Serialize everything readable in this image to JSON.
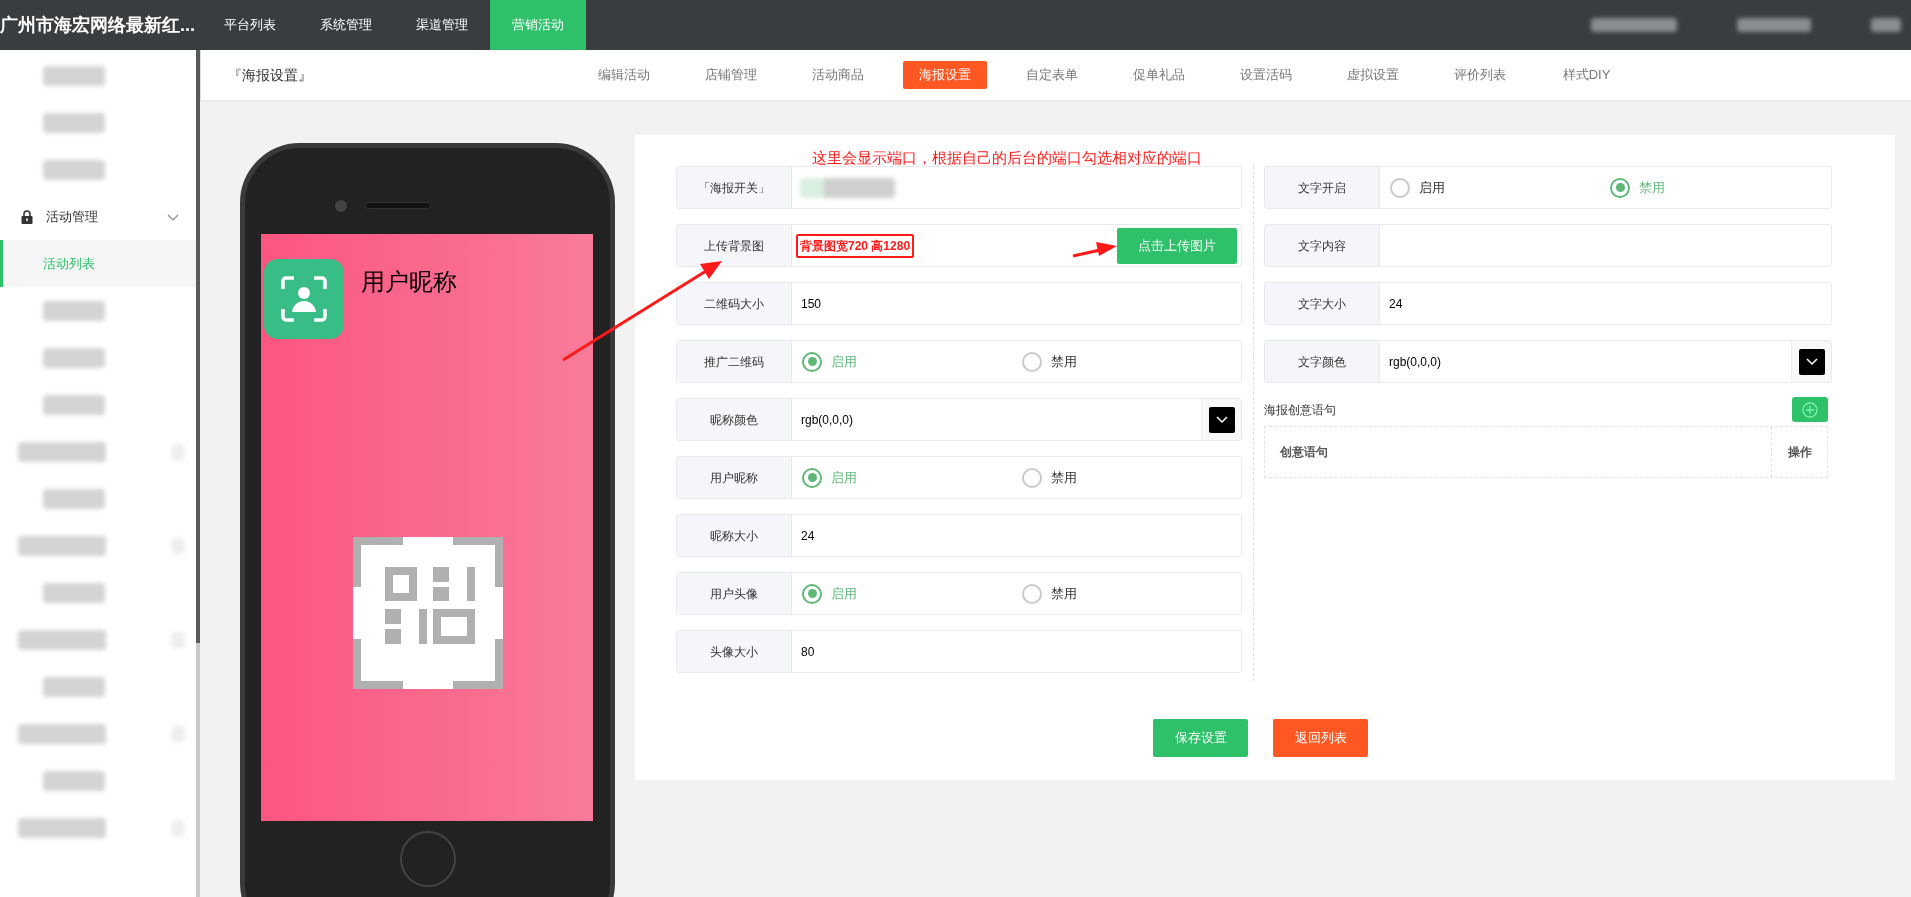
{
  "app_title": "广州市海宏网络最新红...",
  "top_nav": [
    {
      "label": "平台列表",
      "selected": false
    },
    {
      "label": "系统管理",
      "selected": false
    },
    {
      "label": "渠道管理",
      "selected": false
    },
    {
      "label": "营销活动",
      "selected": true
    }
  ],
  "sidebar": {
    "items": [
      {
        "label": "活动管理",
        "expanded": true,
        "children": [
          {
            "label": "活动列表",
            "selected": true
          }
        ]
      }
    ]
  },
  "page_title": "『海报设置』",
  "tabs": [
    {
      "label": "编辑活动",
      "selected": false
    },
    {
      "label": "店铺管理",
      "selected": false
    },
    {
      "label": "活动商品",
      "selected": false
    },
    {
      "label": "海报设置",
      "selected": true
    },
    {
      "label": "自定表单",
      "selected": false
    },
    {
      "label": "促单礼品",
      "selected": false
    },
    {
      "label": "设置活码",
      "selected": false
    },
    {
      "label": "虚拟设置",
      "selected": false
    },
    {
      "label": "评价列表",
      "selected": false
    },
    {
      "label": "样式DIY",
      "selected": false
    }
  ],
  "poster_preview": {
    "nickname": "用户昵称"
  },
  "annotation": "这里会显示端口，根据自己的后台的端口勾选相对应的端口",
  "form_left": [
    {
      "kind": "redacted",
      "label": "「海报开关」"
    },
    {
      "kind": "upload",
      "label": "上传背景图",
      "hint": "背景图宽720 高1280",
      "button": "点击上传图片"
    },
    {
      "kind": "input",
      "label": "二维码大小",
      "value": "150"
    },
    {
      "kind": "radio",
      "label": "推广二维码",
      "options": [
        {
          "label": "启用",
          "selected": true
        },
        {
          "label": "禁用",
          "selected": false
        }
      ]
    },
    {
      "kind": "color",
      "label": "昵称颜色",
      "value": "rgb(0,0,0)"
    },
    {
      "kind": "radio",
      "label": "用户昵称",
      "options": [
        {
          "label": "启用",
          "selected": true
        },
        {
          "label": "禁用",
          "selected": false
        }
      ]
    },
    {
      "kind": "input",
      "label": "昵称大小",
      "value": "24"
    },
    {
      "kind": "radio",
      "label": "用户头像",
      "options": [
        {
          "label": "启用",
          "selected": true
        },
        {
          "label": "禁用",
          "selected": false
        }
      ]
    },
    {
      "kind": "input",
      "label": "头像大小",
      "value": "80"
    }
  ],
  "form_right": [
    {
      "kind": "radio",
      "label": "文字开启",
      "options": [
        {
          "label": "启用",
          "selected": false
        },
        {
          "label": "禁用",
          "selected": true
        }
      ]
    },
    {
      "kind": "input",
      "label": "文字内容"
    },
    {
      "kind": "input",
      "label": "文字大小",
      "value": "24"
    },
    {
      "kind": "color",
      "label": "文字颜色",
      "value": "rgb(0,0,0)"
    }
  ],
  "slogans": {
    "title": "海报创意语句",
    "columns": [
      "创意语句",
      "操作"
    ]
  },
  "buttons": [
    {
      "label": "保存设置",
      "kind": "primary"
    },
    {
      "label": "返回列表",
      "kind": "danger"
    }
  ]
}
